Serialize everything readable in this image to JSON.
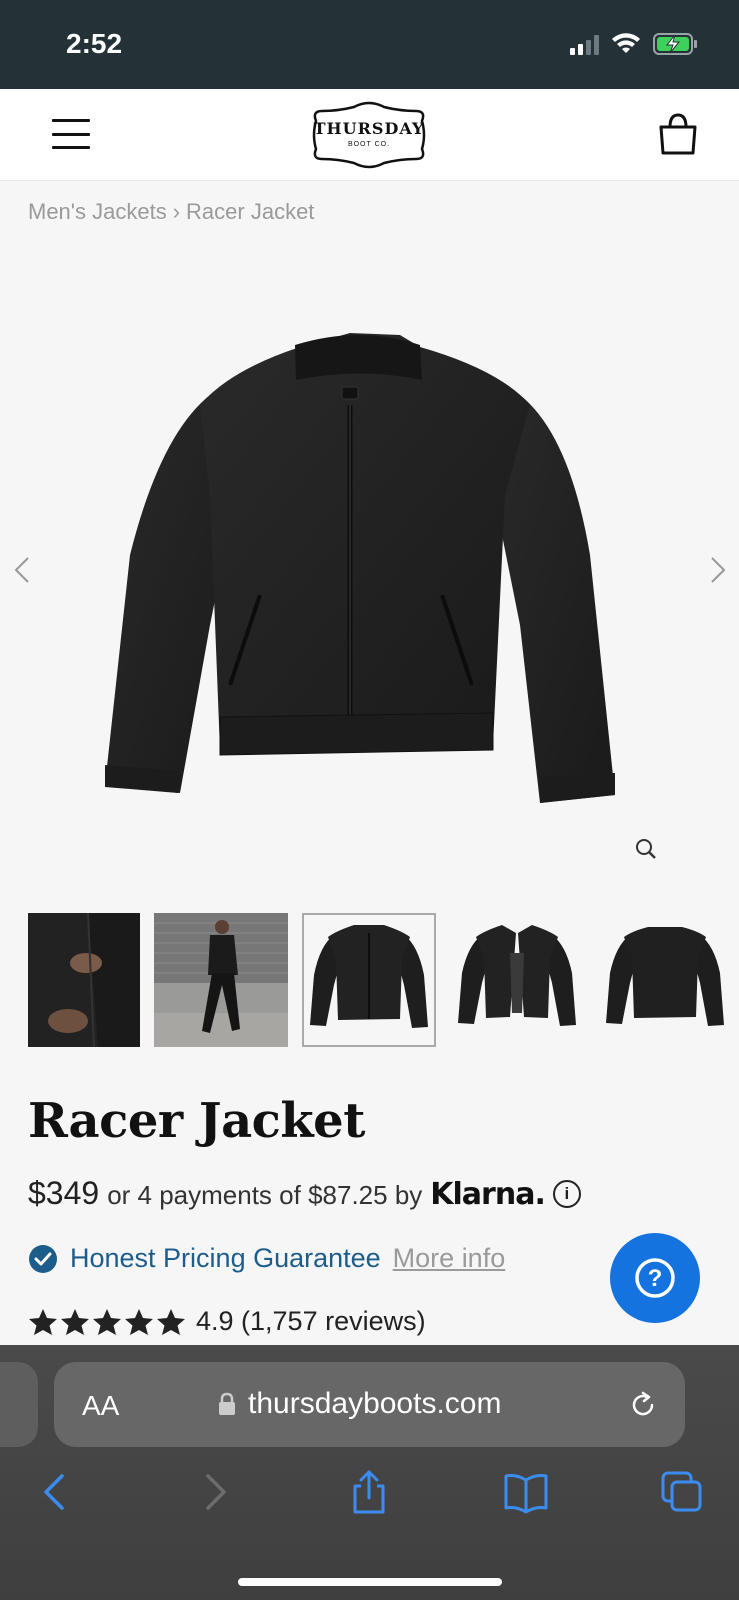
{
  "status_bar": {
    "time": "2:52"
  },
  "header": {
    "logo_text": "THURSDAY",
    "logo_sub": "BOOT CO."
  },
  "breadcrumb": {
    "parent": "Men's Jackets",
    "separator": "›",
    "current": "Racer Jacket"
  },
  "product": {
    "title": "Racer Jacket",
    "price": "$349",
    "installments": "or 4 payments of $87.25 by",
    "klarna": "Klarna.",
    "info_glyph": "i",
    "guarantee_label": "Honest Pricing Guarantee",
    "more_info": "More info",
    "rating": 4.9,
    "rating_text": "4.9 (1,757 reviews)",
    "stars": 5
  },
  "thumbnails": [
    {
      "name": "detail-closeup"
    },
    {
      "name": "model-walking"
    },
    {
      "name": "front-view",
      "selected": true
    },
    {
      "name": "open-front-view"
    },
    {
      "name": "back-view"
    }
  ],
  "help": {
    "glyph": "?"
  },
  "browser": {
    "aa_label": "AA",
    "url": "thursdayboots.com"
  },
  "colors": {
    "status_bar_bg": "#243238",
    "accent_blue": "#1d5d8c",
    "help_blue": "#1573e0",
    "safari_icon_blue": "#3c8cf0"
  }
}
